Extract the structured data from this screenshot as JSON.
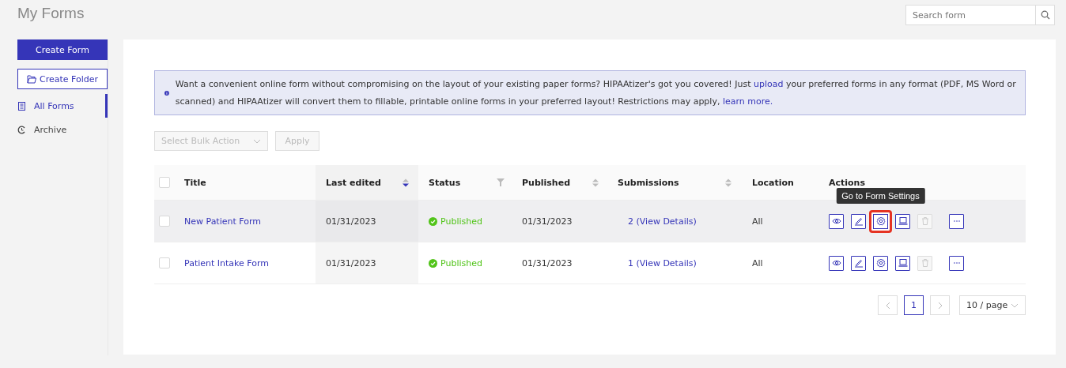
{
  "page_title": "My Forms",
  "search": {
    "placeholder": "Search form"
  },
  "sidebar": {
    "create_form": "Create Form",
    "create_folder": "Create Folder",
    "items": [
      {
        "label": "All Forms",
        "kind": "forms",
        "selected": true
      },
      {
        "label": "Archive",
        "kind": "archive",
        "selected": false
      }
    ]
  },
  "banner": {
    "text": "Want a convenient online form without compromising on the layout of your existing paper forms? HIPAAtizer's got you covered! Just ",
    "link1": "upload",
    "text2": " your preferred forms in any format (PDF, MS Word or scanned) and HIPAAtizer will convert them to fillable, printable online forms in your preferred layout! Restrictions may apply, ",
    "link2": "learn more."
  },
  "bulk": {
    "placeholder": "Select Bulk Action",
    "apply": "Apply",
    "disabled": true
  },
  "table": {
    "all_checked": false,
    "columns": [
      {
        "label": "Title",
        "sortable": false,
        "sorted": false,
        "filter": false
      },
      {
        "label": "Last edited",
        "sortable": true,
        "sorted": true,
        "filter": false
      },
      {
        "label": "Status",
        "sortable": false,
        "sorted": false,
        "filter": true
      },
      {
        "label": "Published",
        "sortable": true,
        "sorted": false,
        "filter": false
      },
      {
        "label": "Submissions",
        "sortable": true,
        "sorted": false,
        "filter": false
      },
      {
        "label": "Location",
        "sortable": false,
        "sorted": false,
        "filter": false
      },
      {
        "label": "Actions",
        "sortable": false,
        "sorted": false,
        "filter": false
      }
    ],
    "rows": [
      {
        "checked": false,
        "hovered": true,
        "title": "New Patient Form",
        "last_edited": "01/31/2023",
        "status": "Published",
        "published": "01/31/2023",
        "submissions": "2 (View Details)",
        "location": "All",
        "actions": [
          {
            "kind": "view",
            "disabled": false,
            "highlighted": false
          },
          {
            "kind": "edit",
            "disabled": false,
            "highlighted": false
          },
          {
            "kind": "settings",
            "disabled": false,
            "highlighted": true
          },
          {
            "kind": "embed",
            "disabled": false,
            "highlighted": false
          },
          {
            "kind": "delete",
            "disabled": true,
            "highlighted": false
          },
          {
            "kind": "more",
            "disabled": false,
            "highlighted": false
          }
        ]
      },
      {
        "checked": false,
        "hovered": false,
        "title": "Patient Intake Form",
        "last_edited": "01/31/2023",
        "status": "Published",
        "published": "01/31/2023",
        "submissions": "1 (View Details)",
        "location": "All",
        "actions": [
          {
            "kind": "view",
            "disabled": false,
            "highlighted": false
          },
          {
            "kind": "edit",
            "disabled": false,
            "highlighted": false
          },
          {
            "kind": "settings",
            "disabled": false,
            "highlighted": false
          },
          {
            "kind": "embed",
            "disabled": false,
            "highlighted": false
          },
          {
            "kind": "delete",
            "disabled": true,
            "highlighted": false
          },
          {
            "kind": "more",
            "disabled": false,
            "highlighted": false
          }
        ]
      }
    ]
  },
  "tooltip": {
    "text": "Go to Form Settings"
  },
  "pagination": {
    "pages": [
      {
        "label": "1",
        "selected": true
      }
    ],
    "page_size": "10 / page"
  }
}
